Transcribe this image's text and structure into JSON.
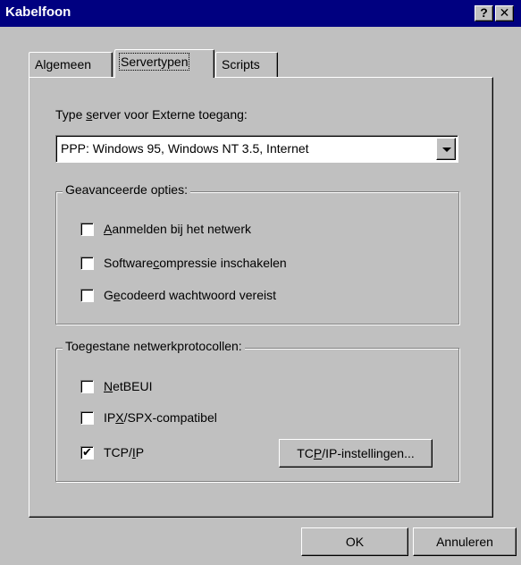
{
  "window": {
    "title": "Kabelfoon",
    "help_button": "?",
    "close_button": "✕"
  },
  "tabs": [
    {
      "label": "Algemeen",
      "active": false
    },
    {
      "label": "Servertypen",
      "active": true
    },
    {
      "label": "Scripts",
      "active": false
    }
  ],
  "server_type": {
    "label_pre": "Type ",
    "label_accel": "s",
    "label_post": "erver voor Externe toegang:",
    "value": "PPP: Windows 95, Windows NT 3.5, Internet"
  },
  "advanced": {
    "legend": "Geavanceerde opties:",
    "options": [
      {
        "pre": "",
        "accel": "A",
        "post": "anmelden bij het netwerk",
        "checked": false
      },
      {
        "pre": "Software",
        "accel": "c",
        "post": "ompressie inschakelen",
        "checked": false
      },
      {
        "pre": "G",
        "accel": "e",
        "post": "codeerd wachtwoord vereist",
        "checked": false
      }
    ]
  },
  "protocols": {
    "legend": "Toegestane netwerkprotocollen:",
    "options": [
      {
        "pre": "",
        "accel": "N",
        "post": "etBEUI",
        "checked": false
      },
      {
        "pre": "IP",
        "accel": "X",
        "post": "/SPX-compatibel",
        "checked": true
      },
      {
        "pre": "TCP/",
        "accel": "I",
        "post": "P",
        "checked": true
      }
    ],
    "settings_button": {
      "pre": "TC",
      "accel": "P",
      "post": "/IP-instellingen..."
    }
  },
  "footer": {
    "ok": "OK",
    "cancel": "Annuleren"
  },
  "check_mark": "✔",
  "colors": {
    "titlebar": "#000080",
    "face": "#c0c0c0"
  }
}
